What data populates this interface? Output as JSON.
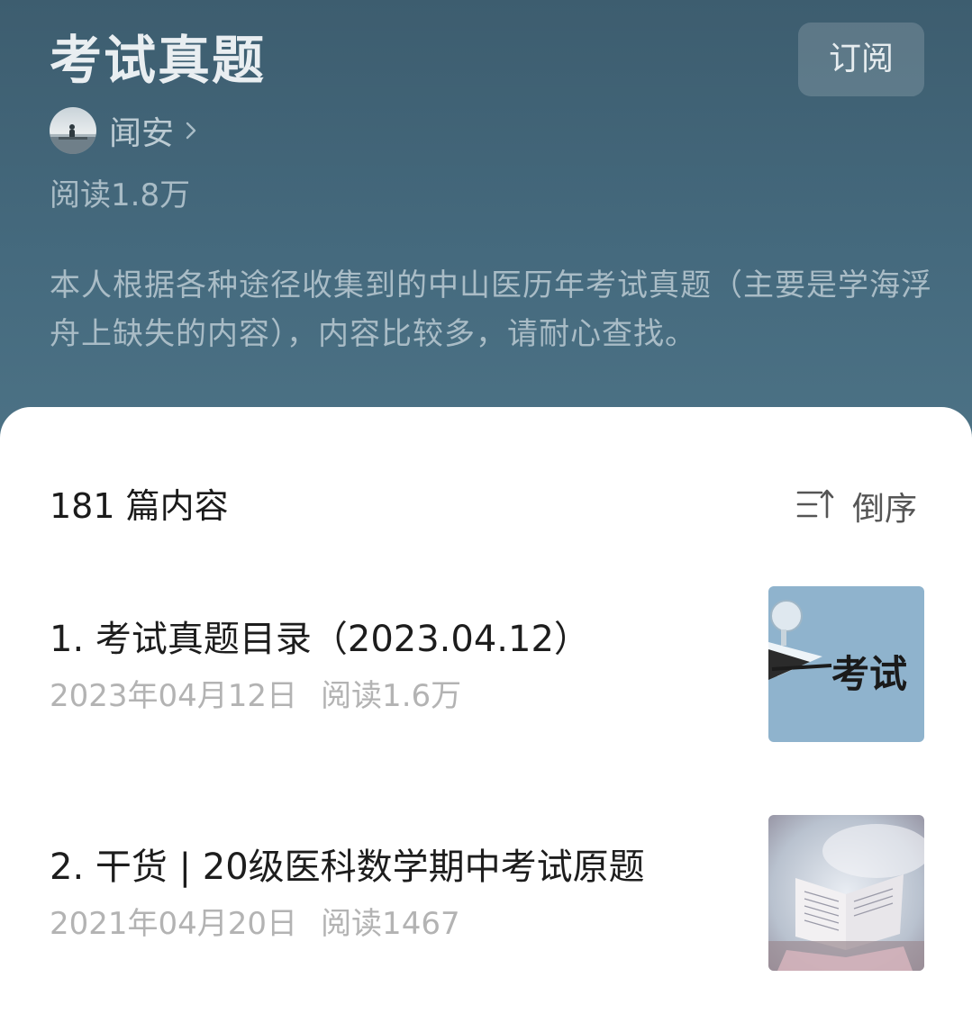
{
  "header": {
    "title": "考试真题",
    "subscribe_label": "订阅",
    "author": {
      "name": "闻安",
      "avatar_icon": "avatar-photo",
      "chevron_icon": "chevron-right-icon"
    },
    "read_count": "阅读1.8万",
    "description": "本人根据各种途径收集到的中山医历年考试真题（主要是学海浮舟上缺失的内容），内容比较多，请耐心查找。"
  },
  "list": {
    "count_label": "181 篇内容",
    "sort_label": "倒序",
    "sort_icon": "sort-order-icon",
    "articles": [
      {
        "title": "1. 考试真题目录（2023.04.12）",
        "date": "2023年04月12日",
        "reads": "阅读1.6万",
        "thumbnail_text": "考试"
      },
      {
        "title": "2. 干货 | 20级医科数学期中考试原题",
        "date": "2021年04月20日",
        "reads": "阅读1467"
      }
    ]
  },
  "colors": {
    "header_bg": "#456a7e",
    "title_text": "#e9eef1",
    "muted_header_text": "#a9bcc6",
    "meta_text": "#b3b3b3"
  }
}
